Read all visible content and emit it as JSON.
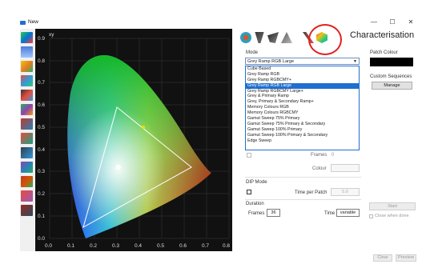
{
  "window": {
    "title": "New",
    "minimize": "—",
    "maximize": "☐",
    "close": "✕"
  },
  "heading": "Characterisation",
  "mode": {
    "label": "Mode",
    "selected": "Grey Ramp RGB Large",
    "options": [
      "Cube Based",
      "Grey Ramp RGB",
      "Grey Ramp RGBCMY+",
      "Grey Ramp RGB Large",
      "Grey Ramp RGBCMY Large+",
      "Grey & Primary Ramp",
      "Grey, Primary & Secondary Ramp+",
      "Memory Colours RGB",
      "Memory Colours RGBCMY",
      "Gamut Sweep 75% Primary",
      "Gamut Sweep 75% Primary & Secondary",
      "Gamut Sweep 100% Primary",
      "Gamut Sweep 100% Primary & Secondary",
      "Edge Sweep"
    ]
  },
  "patch_colour": {
    "label": "Patch Colour",
    "color": "#000000"
  },
  "custom_sequences": {
    "label": "Custom Sequences",
    "manage": "Manage"
  },
  "frames_field": {
    "label": "Frames",
    "value": "0"
  },
  "colour_field": {
    "label": "Colour"
  },
  "dip_mode": {
    "label": "DIP Mode",
    "time_per_patch_label": "Time per Patch",
    "time_per_patch_value": "5.0"
  },
  "duration": {
    "label": "Duration",
    "frames_label": "Frames",
    "frames_value": "36",
    "time_label": "Time",
    "time_value": "variable"
  },
  "start": "Start",
  "close_when_done": "Close when done",
  "footer": {
    "clear": "Clear",
    "preview": "Preview"
  },
  "plot": {
    "ylabel": "xy",
    "yticks": [
      "0.9",
      "0.8",
      "0.7",
      "0.6",
      "0.5",
      "0.4",
      "0.3",
      "0.2",
      "0.1",
      "0.0"
    ],
    "xticks": [
      "0.0",
      "0.1",
      "0.2",
      "0.3",
      "0.4",
      "0.5",
      "0.6",
      "0.7",
      "0.8"
    ]
  }
}
